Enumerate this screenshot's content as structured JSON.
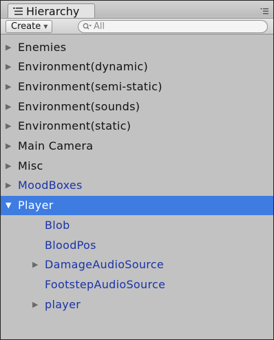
{
  "window": {
    "tab_title": "Hierarchy",
    "tab_icon": "hierarchy-list-icon",
    "menu_icon": "panel-menu-icon"
  },
  "toolbar": {
    "create_label": "Create",
    "search_placeholder": "All",
    "search_icon": "search-icon"
  },
  "colors": {
    "panel_bg": "#c2c2c2",
    "selection": "#3e7ce2",
    "prefab_text": "#1a33a6",
    "normal_text": "#111111"
  },
  "tree": [
    {
      "label": "Enemies",
      "expanded": false,
      "has_children": true,
      "depth": 0,
      "style": "normal"
    },
    {
      "label": "Environment(dynamic)",
      "expanded": false,
      "has_children": true,
      "depth": 0,
      "style": "normal"
    },
    {
      "label": "Environment(semi-static)",
      "expanded": false,
      "has_children": true,
      "depth": 0,
      "style": "normal"
    },
    {
      "label": "Environment(sounds)",
      "expanded": false,
      "has_children": true,
      "depth": 0,
      "style": "normal"
    },
    {
      "label": "Environment(static)",
      "expanded": false,
      "has_children": true,
      "depth": 0,
      "style": "normal"
    },
    {
      "label": "Main Camera",
      "expanded": false,
      "has_children": true,
      "depth": 0,
      "style": "normal"
    },
    {
      "label": "Misc",
      "expanded": false,
      "has_children": true,
      "depth": 0,
      "style": "normal"
    },
    {
      "label": "MoodBoxes",
      "expanded": false,
      "has_children": true,
      "depth": 0,
      "style": "prefab"
    },
    {
      "label": "Player",
      "expanded": true,
      "has_children": true,
      "depth": 0,
      "style": "selected"
    },
    {
      "label": "Blob",
      "expanded": false,
      "has_children": false,
      "depth": 1,
      "style": "prefab"
    },
    {
      "label": "BloodPos",
      "expanded": false,
      "has_children": false,
      "depth": 1,
      "style": "prefab"
    },
    {
      "label": "DamageAudioSource",
      "expanded": false,
      "has_children": true,
      "depth": 1,
      "style": "prefab"
    },
    {
      "label": "FootstepAudioSource",
      "expanded": false,
      "has_children": false,
      "depth": 1,
      "style": "prefab"
    },
    {
      "label": "player",
      "expanded": false,
      "has_children": true,
      "depth": 1,
      "style": "prefab"
    }
  ]
}
